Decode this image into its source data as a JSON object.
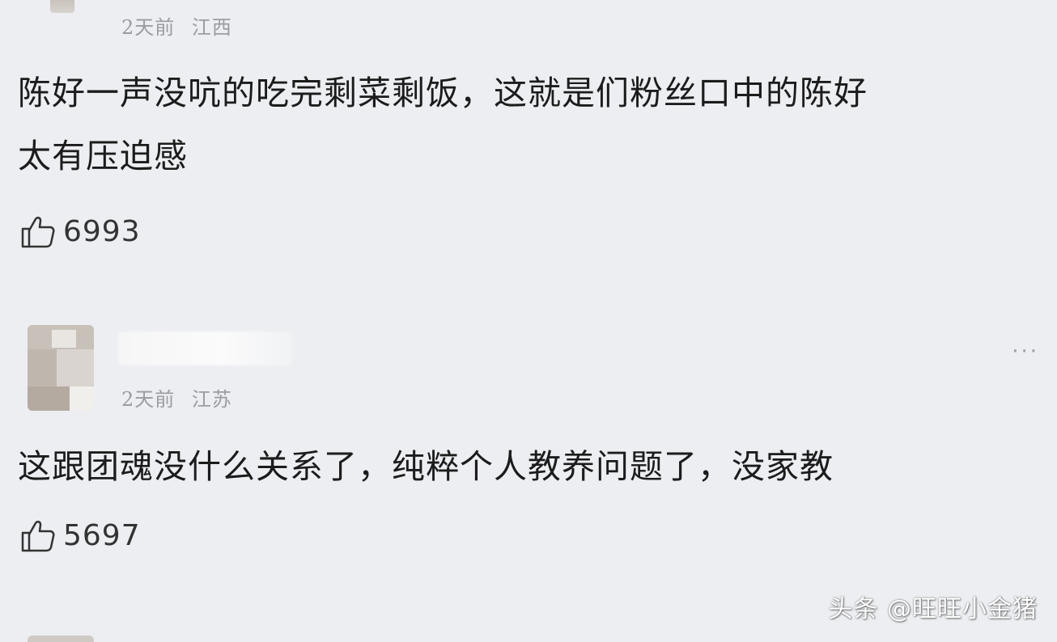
{
  "comments": [
    {
      "meta": {
        "time": "2天前",
        "location": "江西"
      },
      "text_lines": [
        "陈好一声没吭的吃完剩菜剩饭，这就是们粉丝口中的陈好",
        "太有压迫感"
      ],
      "likes": "6993"
    },
    {
      "meta": {
        "time": "2天前",
        "location": "江苏"
      },
      "text_lines": [
        "这跟团魂没什么关系了，纯粹个人教养问题了，没家教"
      ],
      "likes": "5697"
    }
  ],
  "more_icon": "more-dots-icon",
  "like_icon": "thumbs-up-icon",
  "watermark": "头条 @旺旺小金猪",
  "colors": {
    "background": "#eceef1",
    "text": "#1c1c1c",
    "meta": "#9a9ca0"
  }
}
